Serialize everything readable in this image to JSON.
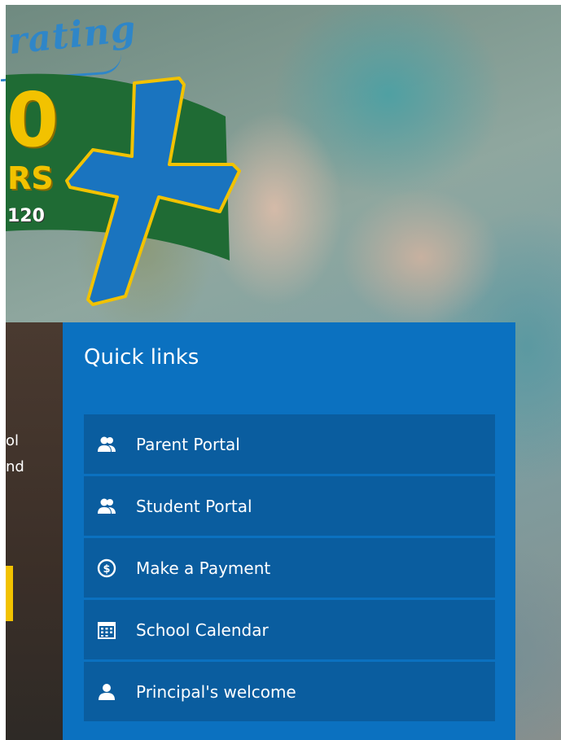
{
  "hero": {
    "script_text": "rating",
    "badge_number": "0",
    "badge_word": "RS",
    "badge_year": "120",
    "cut_text_lines": [
      "ol",
      "nd"
    ]
  },
  "quick_links": {
    "title": "Quick links",
    "items": [
      {
        "label": "Parent Portal",
        "icon": "users-icon"
      },
      {
        "label": "Student Portal",
        "icon": "users-icon"
      },
      {
        "label": "Make a Payment",
        "icon": "dollar-circle-icon"
      },
      {
        "label": "School Calendar",
        "icon": "calendar-icon"
      },
      {
        "label": "Principal's welcome",
        "icon": "user-icon"
      }
    ]
  },
  "colors": {
    "panel_bg": "#0b71c0",
    "link_bg": "#0a5d9f",
    "accent_yellow": "#f2c200",
    "banner_green": "#1f6b34",
    "cross_blue": "#1a74bf"
  }
}
